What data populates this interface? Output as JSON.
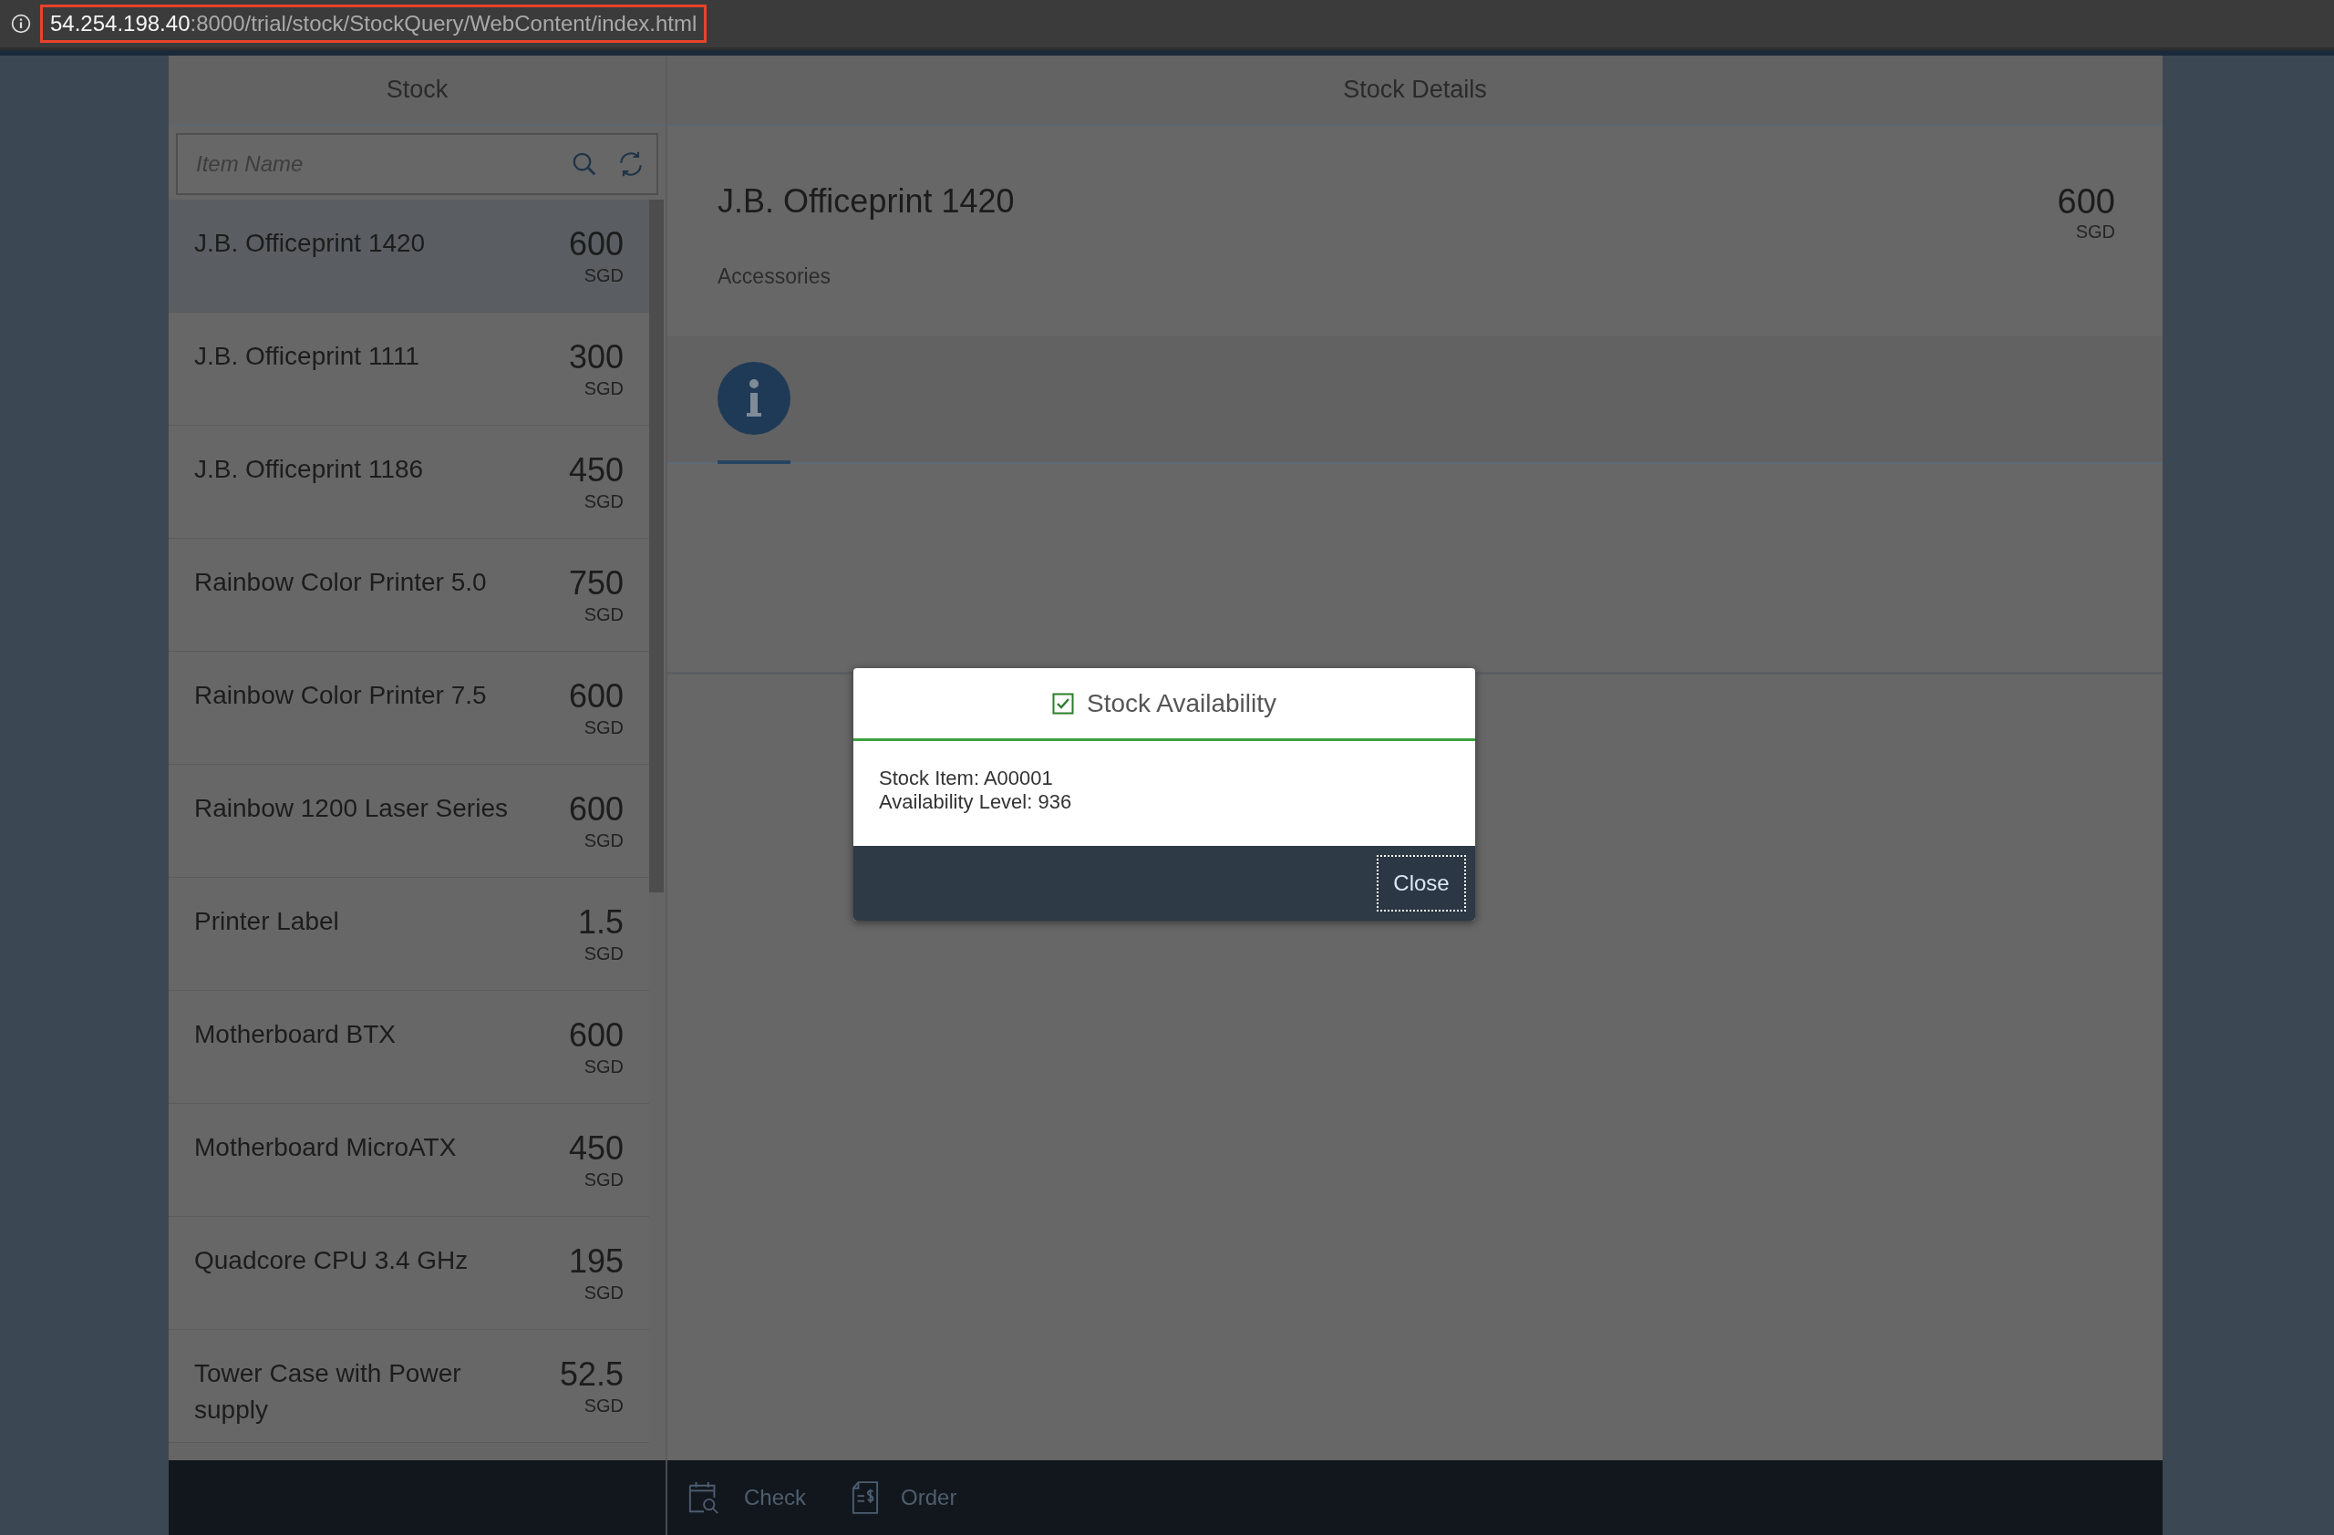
{
  "browser": {
    "url_host": "54.254.198.40",
    "url_path": ":8000/trial/stock/StockQuery/WebContent/index.html"
  },
  "master": {
    "title": "Stock",
    "search": {
      "placeholder": "Item Name"
    },
    "items": [
      {
        "name": "J.B. Officeprint 1420",
        "price": "600",
        "currency": "SGD",
        "selected": true
      },
      {
        "name": "J.B. Officeprint 1111",
        "price": "300",
        "currency": "SGD",
        "selected": false
      },
      {
        "name": "J.B. Officeprint 1186",
        "price": "450",
        "currency": "SGD",
        "selected": false
      },
      {
        "name": "Rainbow Color Printer 5.0",
        "price": "750",
        "currency": "SGD",
        "selected": false
      },
      {
        "name": "Rainbow Color Printer 7.5",
        "price": "600",
        "currency": "SGD",
        "selected": false
      },
      {
        "name": "Rainbow 1200 Laser Series",
        "price": "600",
        "currency": "SGD",
        "selected": false
      },
      {
        "name": "Printer Label",
        "price": "1.5",
        "currency": "SGD",
        "selected": false
      },
      {
        "name": "Motherboard BTX",
        "price": "600",
        "currency": "SGD",
        "selected": false
      },
      {
        "name": "Motherboard MicroATX",
        "price": "450",
        "currency": "SGD",
        "selected": false
      },
      {
        "name": "Quadcore CPU 3.4 GHz",
        "price": "195",
        "currency": "SGD",
        "selected": false
      },
      {
        "name": "Tower Case with Power supply",
        "price": "52.5",
        "currency": "SGD",
        "selected": false
      }
    ]
  },
  "detail": {
    "title": "Stock Details",
    "item": {
      "name": "J.B. Officeprint 1420",
      "category": "Accessories",
      "price": "600",
      "currency": "SGD"
    },
    "icon_tabs": [
      {
        "kind": "info",
        "selected": true
      }
    ]
  },
  "footer": {
    "actions": [
      {
        "kind": "check",
        "label": "Check"
      },
      {
        "kind": "order",
        "label": "Order"
      }
    ]
  },
  "dialog": {
    "title": "Stock Availability",
    "lines": [
      "Stock Item: A00001",
      "Availability Level: 936"
    ],
    "button": "Close"
  }
}
